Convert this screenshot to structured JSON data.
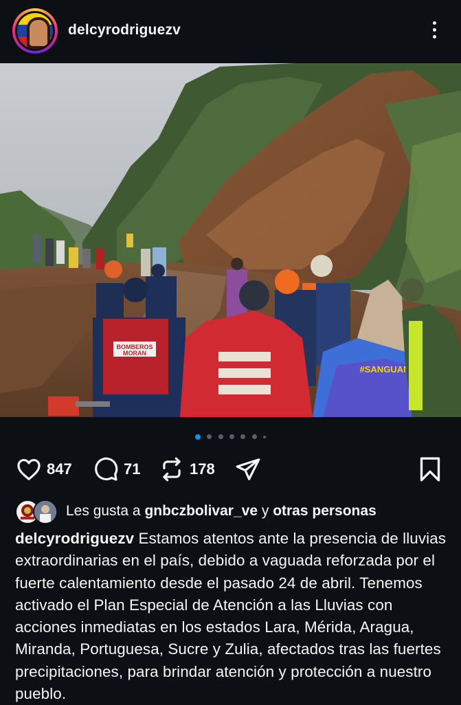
{
  "header": {
    "username": "delcyrodriguezv",
    "more_icon": "more-vertical-icon"
  },
  "post_photo": {
    "description_icon": "photo",
    "vest_labels": {
      "left": "BOMBEROS\nMORAN",
      "center": "BOMBEROS",
      "shirt": "#SANGUAN"
    }
  },
  "carousel": {
    "count": 7,
    "active_index": 0
  },
  "actions": {
    "likes": "847",
    "comments": "71",
    "reposts": "178",
    "icons": [
      "heart-icon",
      "comment-icon",
      "repost-icon",
      "share-icon",
      "bookmark-icon"
    ]
  },
  "liked_by": {
    "prefix": "Les gusta a",
    "user": "gnbczbolivar_ve",
    "connector": "y",
    "others": "otras personas"
  },
  "caption": {
    "username": "delcyrodriguezv",
    "text": "Estamos atentos ante la presencia de lluvias extraordinarias en el país, debido a vaguada reforzada por el fuerte calentamiento desde el pasado 24 de abril. Tenemos activado el Plan Especial de Atención a las Lluvias con acciones inmediatas en los estados Lara, Mérida, Aragua, Miranda, Portuguesa, Sucre y Zulia, afectados tras las fuertes precipitaciones, para brindar atención y protección a nuestro pueblo."
  },
  "colors": {
    "background": "#0c1014",
    "accent": "#0095f6",
    "text": "#f5f5f5"
  }
}
